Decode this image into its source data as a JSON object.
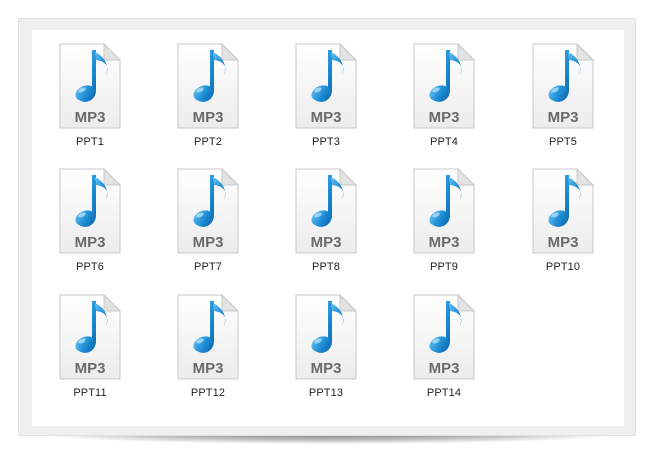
{
  "colors": {
    "note_blue": "#1f8fd6",
    "mp3_text": "#6a6a6a",
    "frame_gray": "#efefef"
  },
  "icon": {
    "name": "mp3-file-icon",
    "badge_text": "MP3"
  },
  "files": [
    {
      "label": "PPT1"
    },
    {
      "label": "PPT2"
    },
    {
      "label": "PPT3"
    },
    {
      "label": "PPT4"
    },
    {
      "label": "PPT5"
    },
    {
      "label": "PPT6"
    },
    {
      "label": "PPT7"
    },
    {
      "label": "PPT8"
    },
    {
      "label": "PPT9"
    },
    {
      "label": "PPT10"
    },
    {
      "label": "PPT11"
    },
    {
      "label": "PPT12"
    },
    {
      "label": "PPT13"
    },
    {
      "label": "PPT14"
    }
  ]
}
